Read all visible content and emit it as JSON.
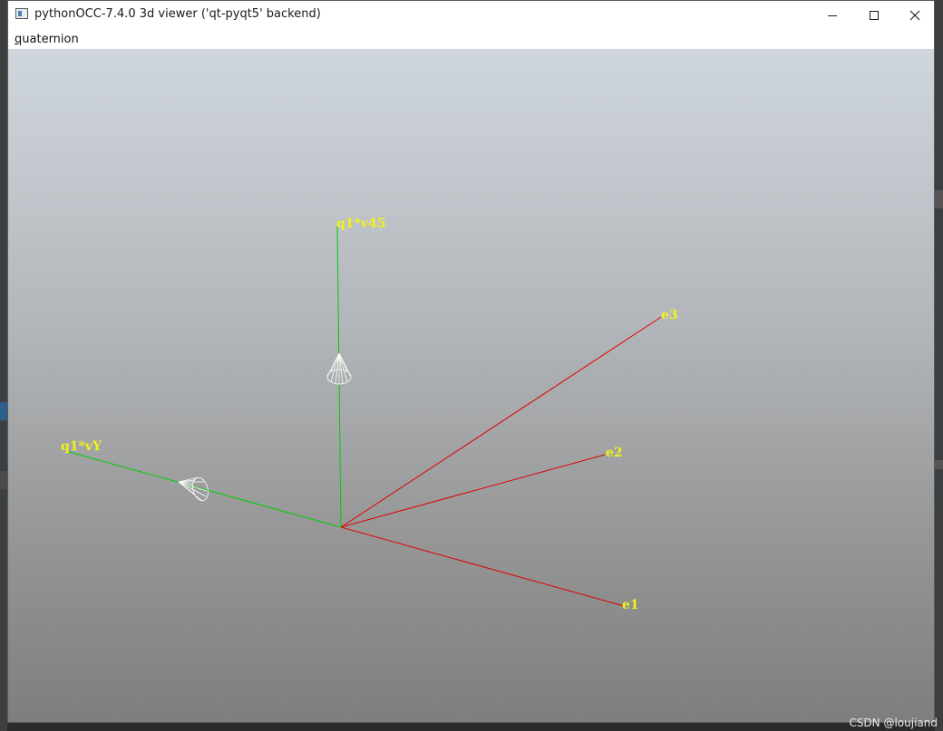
{
  "window": {
    "title": "pythonOCC-7.4.0 3d viewer ('qt-pyqt5' backend)",
    "controls": {
      "minimize_icon": "minimize-icon",
      "maximize_icon": "maximize-icon",
      "close_icon": "close-icon"
    }
  },
  "menubar": {
    "items": [
      {
        "accelerator": "q",
        "rest": "uaternion"
      }
    ]
  },
  "viewport": {
    "background_top": "#cfd6dd",
    "background_bottom": "#7e7e7e",
    "label_color": "#f2f21a",
    "axes": [
      {
        "label": "e1",
        "color": "#e00000"
      },
      {
        "label": "e2",
        "color": "#e00000"
      },
      {
        "label": "e3",
        "color": "#e00000"
      },
      {
        "label": "q1*vY",
        "color": "#00cc00"
      },
      {
        "label": "q1*v45",
        "color": "#00cc00"
      }
    ]
  },
  "watermark": "CSDN @loujiand"
}
